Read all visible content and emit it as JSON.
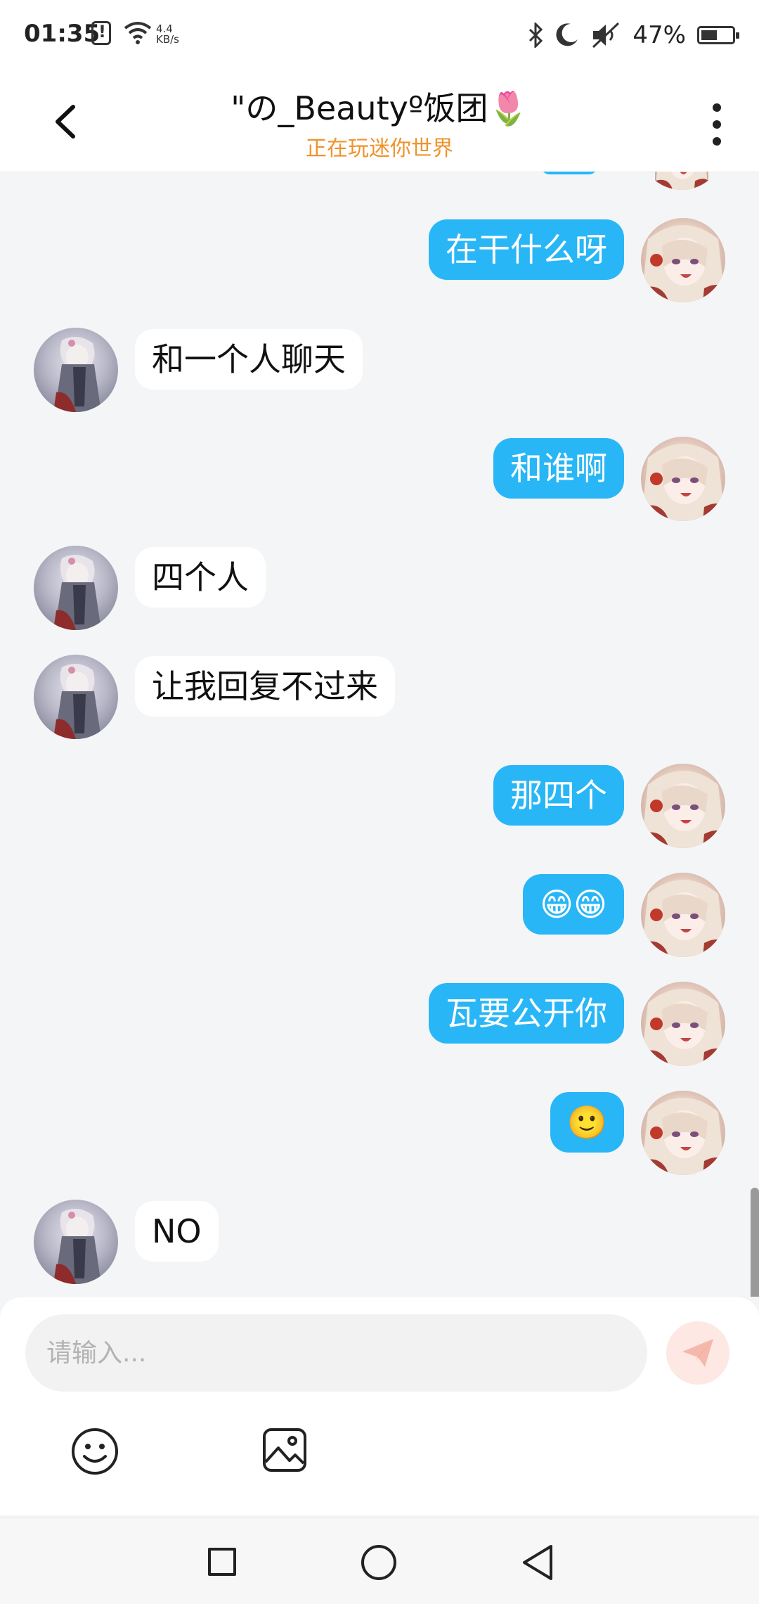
{
  "status_bar": {
    "time": "01:35",
    "speed_value": "4.4",
    "speed_unit": "KB/s",
    "battery": "47%",
    "icons": [
      "alert-icon",
      "wifi-icon",
      "bluetooth-icon",
      "moon-icon",
      "mute-icon",
      "battery-icon"
    ]
  },
  "header": {
    "title": "\"の_Beautyº饭团🌷",
    "subtitle": "正在玩迷你世界",
    "back_icon": "chevron-left-icon",
    "more_icon": "more-vertical-icon"
  },
  "messages": [
    {
      "side": "out",
      "text": "在干什么呀"
    },
    {
      "side": "in",
      "text": "和一个人聊天"
    },
    {
      "side": "out",
      "text": "和谁啊"
    },
    {
      "side": "in",
      "text": "四个人"
    },
    {
      "side": "in",
      "text": "让我回复不过来"
    },
    {
      "side": "out",
      "text": "那四个"
    },
    {
      "side": "out",
      "text": "😁😁"
    },
    {
      "side": "out",
      "text": "瓦要公开你"
    },
    {
      "side": "out",
      "text": "🙂"
    },
    {
      "side": "in",
      "text": "NO"
    }
  ],
  "input": {
    "placeholder": "请输入...",
    "send_icon": "send-icon",
    "tools": [
      "emoji-icon",
      "image-icon"
    ]
  },
  "nav_bar": {
    "buttons": [
      "recents-icon",
      "home-icon",
      "back-icon"
    ]
  },
  "colors": {
    "accent": "#29b6f6",
    "subtitle": "#f0932b",
    "background": "#f4f5f7"
  }
}
